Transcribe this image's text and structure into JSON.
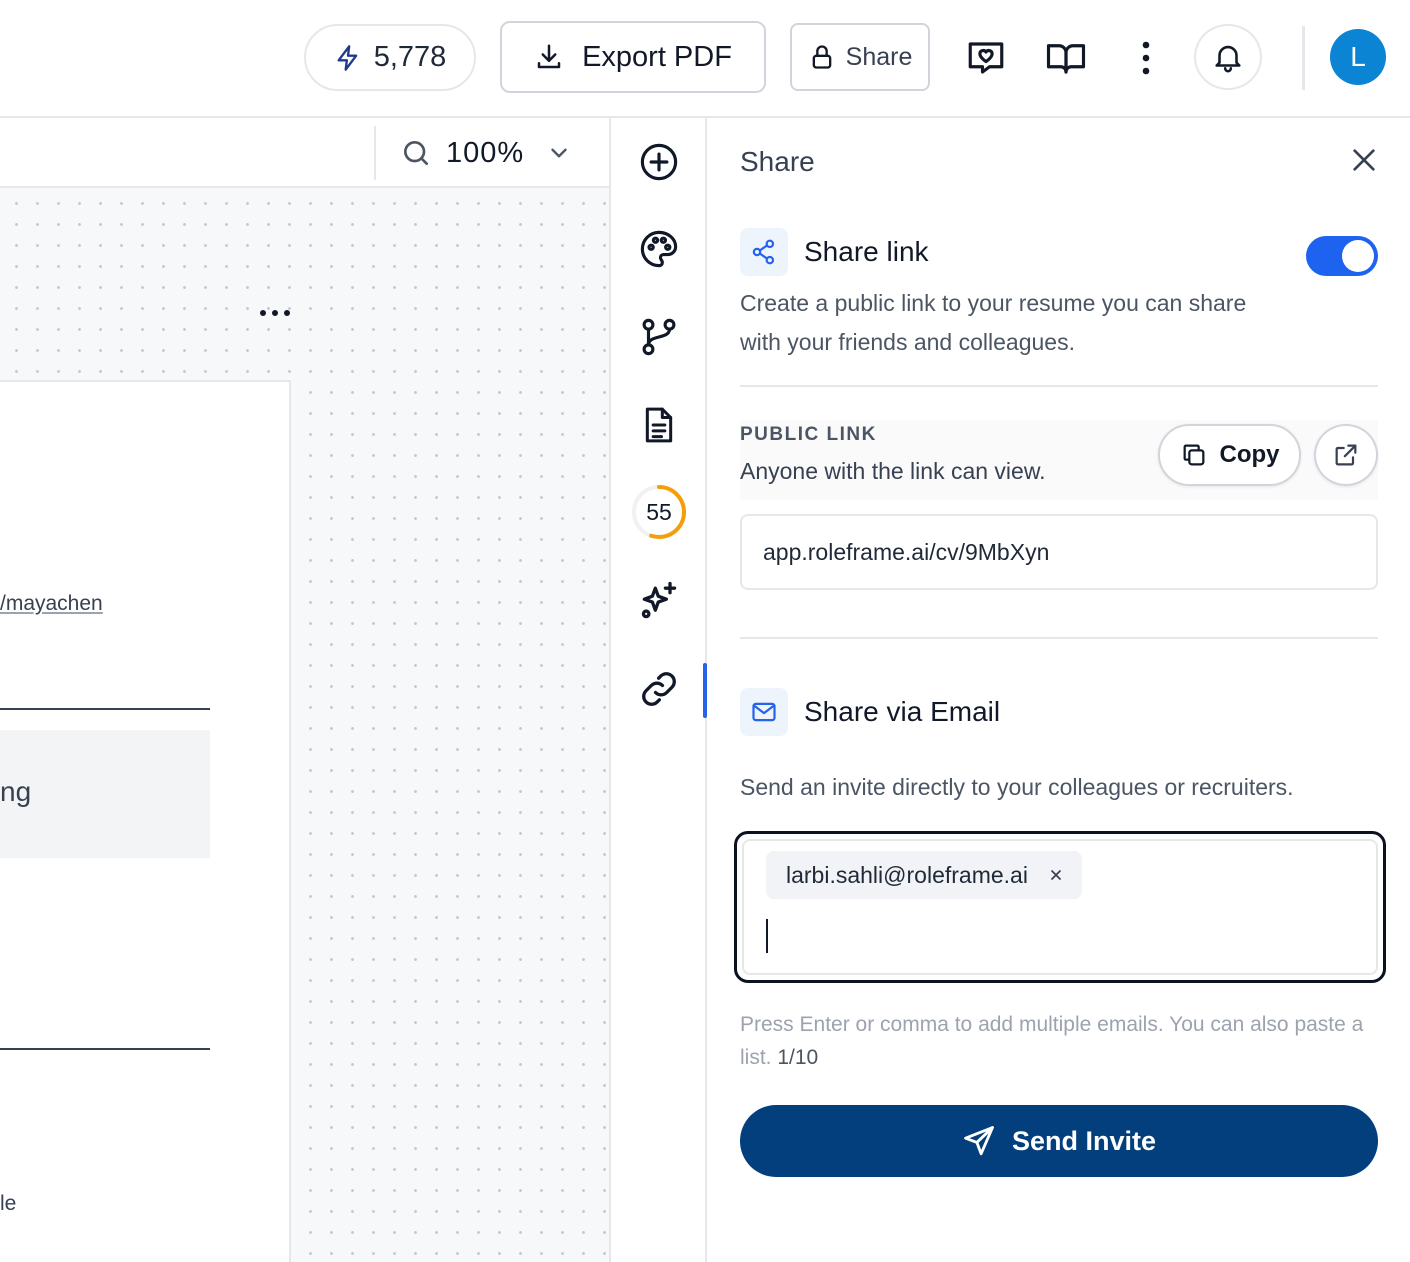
{
  "topbar": {
    "credits": "5,778",
    "export_label": "Export PDF",
    "share_label": "Share",
    "avatar_initial": "L"
  },
  "canvas": {
    "zoom": "100%",
    "page_link": "/mayachen",
    "page_block_text": "ng",
    "page_tail_text": "le"
  },
  "rail": {
    "score": "55",
    "score_fraction": 0.55,
    "icons": [
      "add-icon",
      "palette-icon",
      "branch-icon",
      "document-icon",
      "score-icon",
      "sparkles-icon",
      "link-icon"
    ],
    "active_item": "link-icon"
  },
  "panel": {
    "title": "Share",
    "share_link": {
      "title": "Share link",
      "enabled": true,
      "description": "Create a public link to your resume you can share with your friends and colleagues."
    },
    "public_link": {
      "label": "PUBLIC LINK",
      "subtitle": "Anyone with the link can view.",
      "copy_label": "Copy",
      "url": "app.roleframe.ai/cv/9MbXyn"
    },
    "email": {
      "title": "Share via Email",
      "description": "Send an invite directly to your colleagues or recruiters.",
      "chips": [
        "larbi.sahli@roleframe.ai"
      ],
      "hint": "Press Enter or comma to add multiple emails. You can also paste a list.",
      "count": "1/10",
      "send_label": "Send Invite"
    }
  },
  "colors": {
    "accent": "#1d63f0",
    "primary_button": "#033f7d",
    "avatar": "#0b84d4",
    "score_ring": "#f59e0b"
  }
}
